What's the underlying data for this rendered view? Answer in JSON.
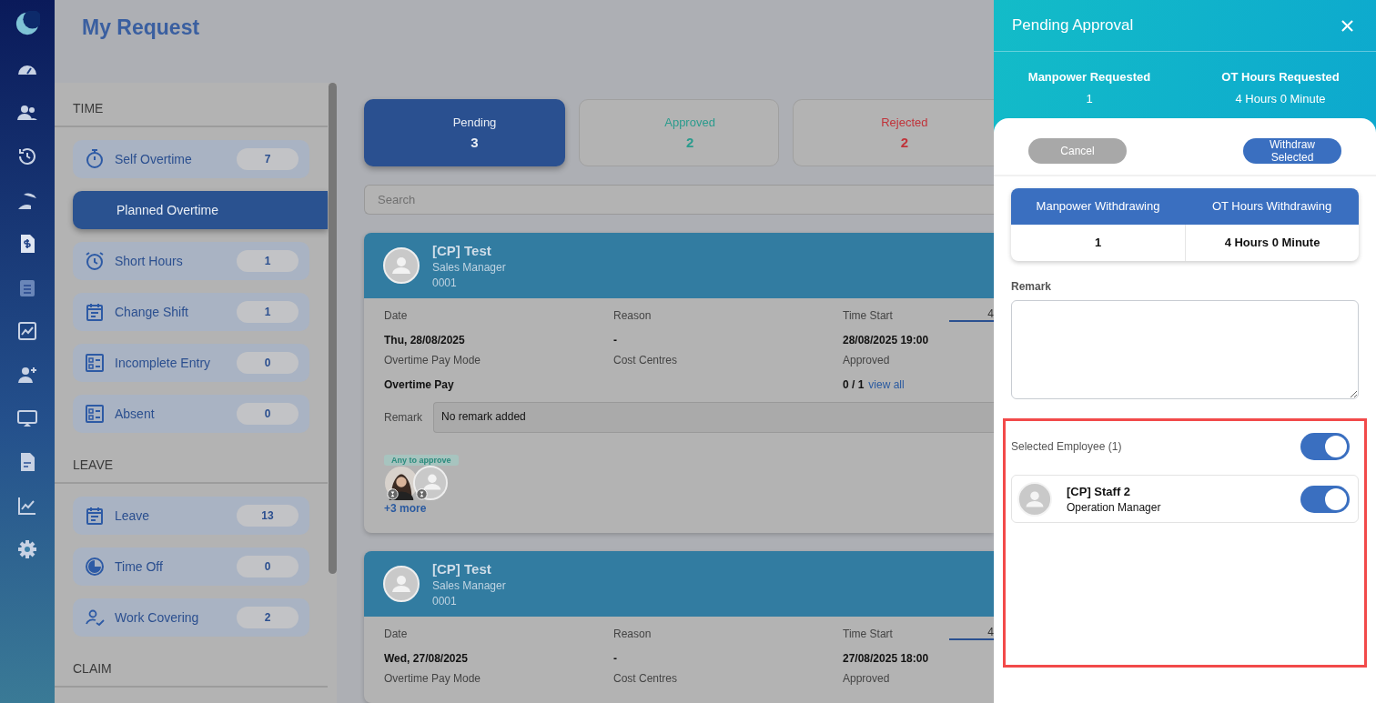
{
  "page": {
    "title": "My Request"
  },
  "sidebar": {
    "sections": [
      {
        "title": "TIME",
        "items": [
          {
            "label": "Self Overtime",
            "count": "7",
            "selected": false
          },
          {
            "label": "Planned Overtime",
            "selected": true
          },
          {
            "label": "Short Hours",
            "count": "1",
            "selected": false
          },
          {
            "label": "Change Shift",
            "count": "1",
            "selected": false
          },
          {
            "label": "Incomplete Entry",
            "count": "0",
            "selected": false
          },
          {
            "label": "Absent",
            "count": "0",
            "selected": false
          }
        ]
      },
      {
        "title": "LEAVE",
        "items": [
          {
            "label": "Leave",
            "count": "13",
            "selected": false
          },
          {
            "label": "Time Off",
            "count": "0",
            "selected": false
          },
          {
            "label": "Work Covering",
            "count": "2",
            "selected": false
          }
        ]
      },
      {
        "title": "CLAIM"
      }
    ]
  },
  "status_tabs": [
    {
      "label": "Pending",
      "count": "3",
      "selected": true,
      "color": "#2a5090"
    },
    {
      "label": "Approved",
      "count": "2",
      "selected": false,
      "color": "#2a9b8d"
    },
    {
      "label": "Rejected",
      "count": "2",
      "selected": false,
      "color": "#c0333a"
    }
  ],
  "search": {
    "placeholder": "Search"
  },
  "requests": [
    {
      "name": "[CP] Test",
      "position": "Sales Manager",
      "code": "0001",
      "timeline_label": "4",
      "fields": [
        {
          "label": "Date",
          "value": "Thu, 28/08/2025"
        },
        {
          "label": "Reason",
          "value": "-"
        },
        {
          "label": "Time Start",
          "value": "28/08/2025 19:00"
        },
        {
          "label": "Overtime Pay Mode",
          "value": "Overtime Pay"
        },
        {
          "label": "Cost Centres"
        },
        {
          "label": "Approved",
          "value": "0 / 1",
          "link": "view all"
        }
      ],
      "remark_label": "Remark",
      "remark": "No remark added",
      "approver_tag": "Any to approve",
      "approvers": [
        {
          "kind": "photo"
        },
        {
          "kind": "default"
        }
      ],
      "more_link": "+3 more"
    },
    {
      "name": "[CP] Test",
      "position": "Sales Manager",
      "code": "0001",
      "timeline_label": "4",
      "fields": [
        {
          "label": "Date",
          "value": "Wed, 27/08/2025"
        },
        {
          "label": "Reason",
          "value": "-"
        },
        {
          "label": "Time Start",
          "value": "27/08/2025 18:00"
        },
        {
          "label": "Overtime Pay Mode"
        },
        {
          "label": "Cost Centres"
        },
        {
          "label": "Approved"
        }
      ]
    }
  ],
  "panel": {
    "title": "Pending Approval",
    "summary": [
      {
        "label": "Manpower Requested",
        "value": "1"
      },
      {
        "label": "OT Hours Requested",
        "value": "4 Hours 0 Minute"
      }
    ],
    "buttons": [
      {
        "label": "Cancel",
        "disabled": true
      },
      {
        "label": "Withdraw Selected",
        "disabled": false
      }
    ],
    "table": {
      "columns": [
        "Manpower Withdrawing",
        "OT Hours Withdrawing"
      ],
      "values": [
        "1",
        "4 Hours 0 Minute"
      ]
    },
    "remark_label": "Remark",
    "selected_label": "Selected Employee (1)",
    "select_all_on": true,
    "employees": [
      {
        "name": "[CP] Staff 2",
        "position": "Operation Manager",
        "on": true
      }
    ]
  }
}
